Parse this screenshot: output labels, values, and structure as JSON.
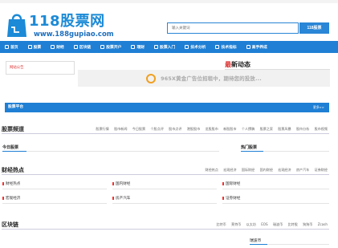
{
  "header": {
    "logo_name": "118股票网",
    "logo_url": "www.188gupiao.com",
    "note": ""
  },
  "search": {
    "placeholder": "输入关键词",
    "button_label": "118股票"
  },
  "nav": {
    "items": [
      {
        "label": "首页"
      },
      {
        "label": "股票"
      },
      {
        "label": "财经"
      },
      {
        "label": "区块链"
      },
      {
        "label": "股票开户"
      },
      {
        "label": "理财"
      },
      {
        "label": "股票入门"
      },
      {
        "label": "技术分析"
      },
      {
        "label": "技术指标"
      },
      {
        "label": "高手养成"
      }
    ]
  },
  "notice": {
    "text": "网站公告"
  },
  "news": {
    "title_hi": "最",
    "title_rest": "新动态",
    "subtitle": ""
  },
  "ad": {
    "text": "965X黄金广告位招租中，期待您的投放..."
  },
  "stock_platform": {
    "label": "股票平台",
    "more": "更多>>"
  },
  "stock_channel": {
    "title": "股票频道",
    "links": [
      "股票行情",
      "股市新闻",
      "今日股票",
      "个股点评",
      "股市点评",
      "港股股市",
      "龙股股市",
      "新股股市",
      "个人撰稿",
      "股票之家",
      "股票风暴",
      "股市分析",
      "股市视频"
    ],
    "left_sub": "今日股票",
    "right_sub": "热门股票"
  },
  "finance": {
    "title": "财经热点",
    "links": [
      "财经热点",
      "宏观经济",
      "国际财经",
      "国内财经",
      "宏观经济",
      "房产汽车",
      "证券财经"
    ],
    "categories": [
      {
        "label": "财经热点"
      },
      {
        "label": "国内财经"
      },
      {
        "label": "国际财经"
      },
      {
        "label": "宏观经济"
      },
      {
        "label": "房产汽车"
      },
      {
        "label": "证券财经"
      }
    ]
  },
  "blockchain": {
    "title": "区块链",
    "links": [
      "比特币",
      "莱特币",
      "以太坊",
      "EOS",
      "瑞波币",
      "比特股",
      "狗狗币",
      "Zcash"
    ],
    "right_sub": "瑞波币"
  }
}
